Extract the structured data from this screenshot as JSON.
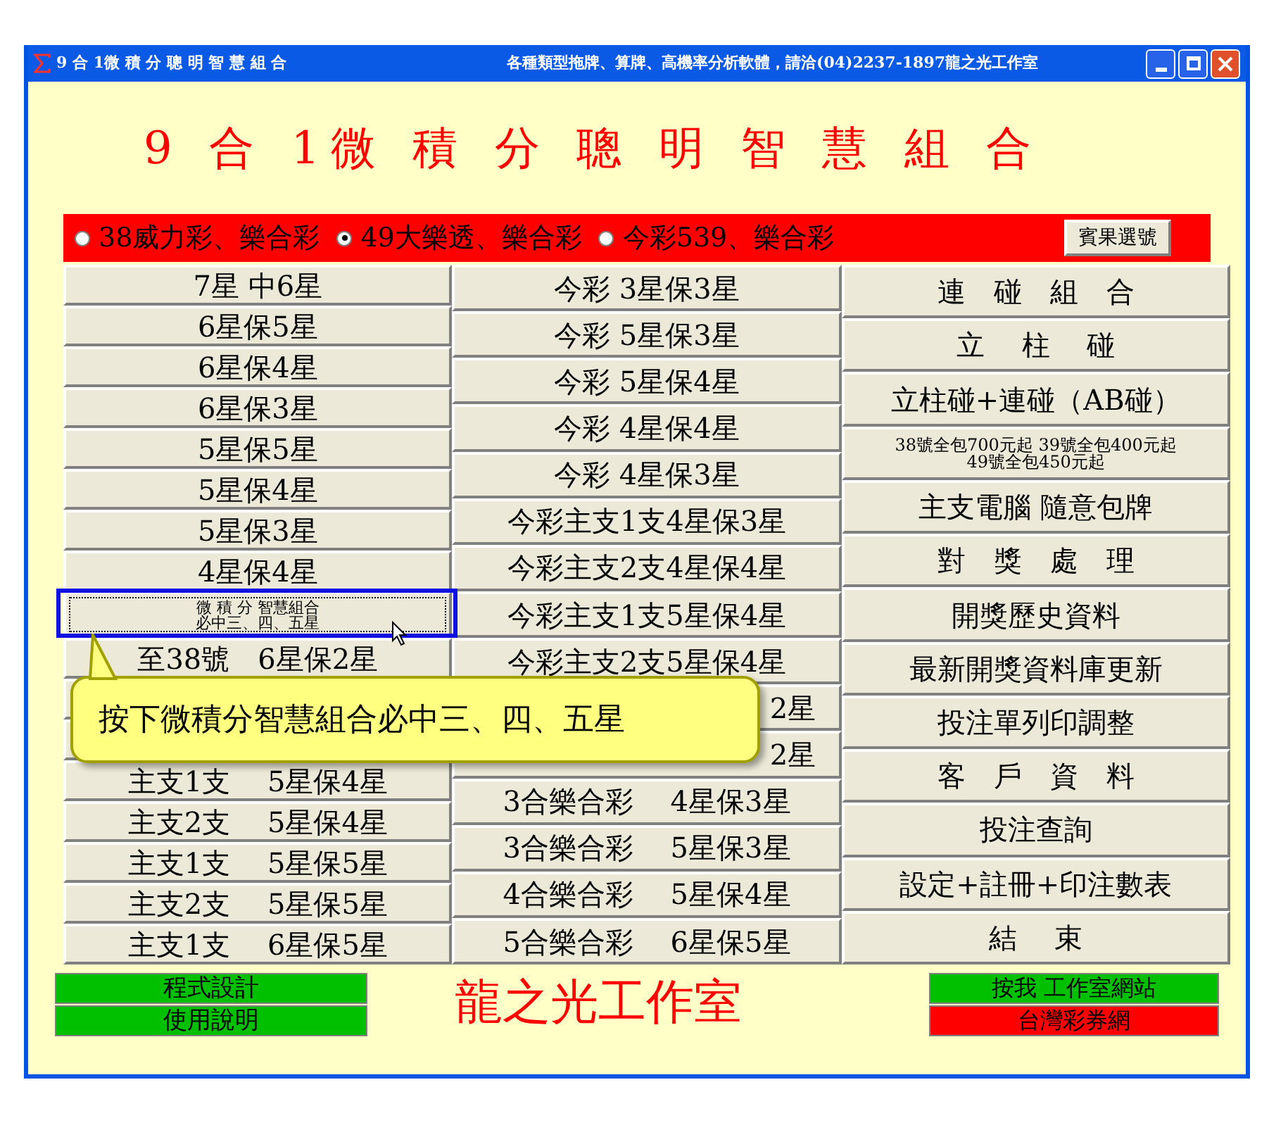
{
  "window": {
    "title": "9 合 1微 積 分 聰 明 智 慧 組 合",
    "subtitle": "各種類型拖牌、算牌、高機率分析軟體，請洽(04)2237-1897龍之光工作室"
  },
  "heading": "9 合 1微 積 分 聰 明 智 慧 組 合",
  "lottery_options": [
    {
      "label": "38威力彩、樂合彩",
      "selected": false
    },
    {
      "label": "49大樂透、樂合彩",
      "selected": true
    },
    {
      "label": "今彩539、樂合彩",
      "selected": false
    }
  ],
  "pick_button": "賓果選號",
  "columns": [
    [
      {
        "kind": "plain",
        "label": "7星 中6星"
      },
      {
        "kind": "plain",
        "label": "6星保5星"
      },
      {
        "kind": "plain",
        "label": "6星保4星"
      },
      {
        "kind": "plain",
        "label": "6星保3星"
      },
      {
        "kind": "plain",
        "label": "5星保5星"
      },
      {
        "kind": "plain",
        "label": "5星保4星"
      },
      {
        "kind": "plain",
        "label": "5星保3星"
      },
      {
        "kind": "plain",
        "label": "4星保4星"
      },
      {
        "kind": "focused",
        "lines": [
          "微 積 分 智慧組合",
          "必中三、四、五星"
        ]
      },
      {
        "kind": "plain",
        "label": "至38號　6星保2星"
      },
      {
        "kind": "covered"
      },
      {
        "kind": "covered"
      },
      {
        "kind": "plain",
        "label": "主支1支　 5星保4星"
      },
      {
        "kind": "plain",
        "label": "主支2支　 5星保4星"
      },
      {
        "kind": "plain",
        "label": "主支1支　 5星保5星"
      },
      {
        "kind": "plain",
        "label": "主支2支　 5星保5星"
      },
      {
        "kind": "plain",
        "label": "主支1支　 6星保5星"
      }
    ],
    [
      {
        "kind": "plain",
        "label": "今彩 3星保3星"
      },
      {
        "kind": "plain",
        "label": "今彩 5星保3星"
      },
      {
        "kind": "plain",
        "label": "今彩 5星保4星"
      },
      {
        "kind": "plain",
        "label": "今彩 4星保4星"
      },
      {
        "kind": "plain",
        "label": "今彩 4星保3星"
      },
      {
        "kind": "plain",
        "label": "今彩主支1支4星保3星"
      },
      {
        "kind": "plain",
        "label": "今彩主支2支4星保4星"
      },
      {
        "kind": "plain",
        "label": "今彩主支1支5星保4星"
      },
      {
        "kind": "plain",
        "label": "今彩主支2支5星保4星"
      },
      {
        "kind": "tail",
        "label": "2星"
      },
      {
        "kind": "tail",
        "label": "2星"
      },
      {
        "kind": "plain",
        "label": "3合樂合彩　 4星保3星"
      },
      {
        "kind": "plain",
        "label": "3合樂合彩　 5星保3星"
      },
      {
        "kind": "plain",
        "label": "4合樂合彩　 5星保4星"
      },
      {
        "kind": "plain",
        "label": "5合樂合彩　 6星保5星"
      }
    ],
    [
      {
        "kind": "plain",
        "label": "連　碰　組　合"
      },
      {
        "kind": "plain",
        "label": "立　 柱　 碰"
      },
      {
        "kind": "plain",
        "label": "立柱碰+連碰（AB碰）"
      },
      {
        "kind": "small",
        "lines": [
          "38號全包700元起 39號全包400元起",
          "49號全包450元起"
        ]
      },
      {
        "kind": "plain",
        "label": "主支電腦 隨意包牌"
      },
      {
        "kind": "plain",
        "label": "對　獎　處　理"
      },
      {
        "kind": "plain",
        "label": "開獎歷史資料"
      },
      {
        "kind": "plain",
        "label": "最新開獎資料庫更新"
      },
      {
        "kind": "plain",
        "label": "投注單列印調整"
      },
      {
        "kind": "plain",
        "label": "客　戶　資　料"
      },
      {
        "kind": "plain",
        "label": "投注查詢"
      },
      {
        "kind": "plain",
        "label": "設定+註冊+印注數表"
      },
      {
        "kind": "plain",
        "label": "結　 束"
      }
    ]
  ],
  "tooltip": "按下微積分智慧組合必中三、四、五星",
  "footer": {
    "left_buttons": [
      {
        "label": "程式設計",
        "color": "#00c000"
      },
      {
        "label": "使用說明",
        "color": "#00c000"
      }
    ],
    "brand": "龍之光工作室",
    "right_buttons": [
      {
        "label": "按我 工作室網站",
        "color": "#00c000"
      },
      {
        "label": "台灣彩券網",
        "color": "#ff0000"
      }
    ]
  }
}
